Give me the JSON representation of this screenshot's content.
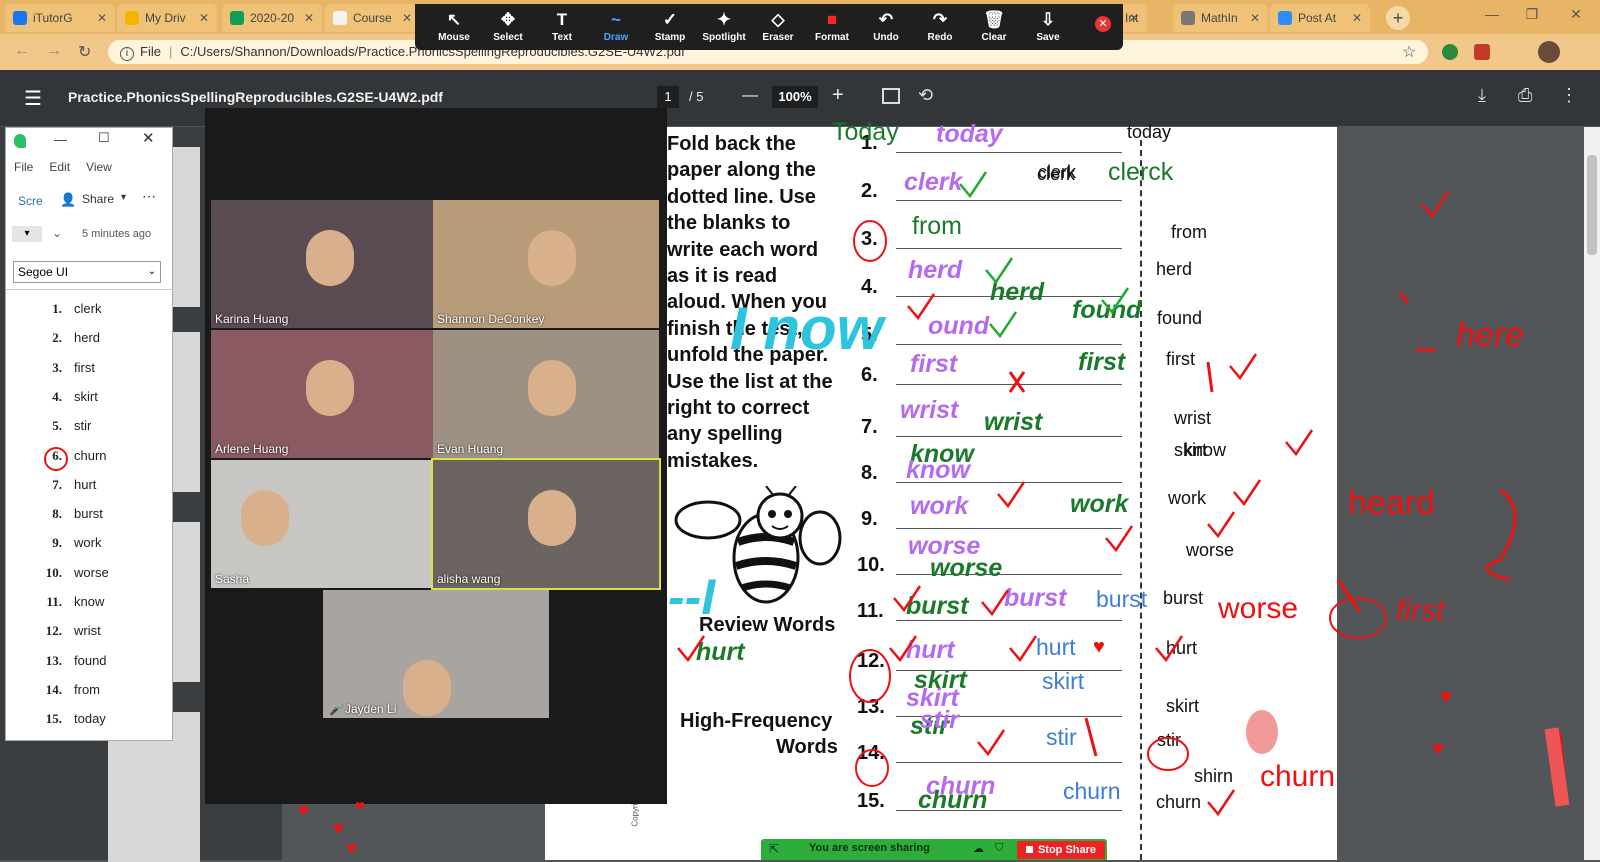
{
  "browser": {
    "tabs": [
      {
        "label": "iTutorG",
        "fav_color": "#1877f2"
      },
      {
        "label": "My Driv",
        "fav_color": "#f4b400"
      },
      {
        "label": "2020-20",
        "fav_color": "#0f9d58"
      },
      {
        "label": "Course",
        "fav_color": "#f3f3f3"
      },
      {
        "label": "Int",
        "fav_color": "#ffffff"
      },
      {
        "label": "MathIn",
        "fav_color": "#777777"
      },
      {
        "label": "Post At",
        "fav_color": "#2d8cff"
      }
    ],
    "new_tab": "+",
    "address_label": "File",
    "url": "C:/Users/Shannon/Downloads/Practice.PhonicsSpellingReproducibles.G2SE-U4W2.pdf"
  },
  "zoom_toolbar": {
    "tools": [
      {
        "label": "Mouse",
        "icon": "↖"
      },
      {
        "label": "Select",
        "icon": "✥"
      },
      {
        "label": "Text",
        "icon": "T"
      },
      {
        "label": "Draw",
        "icon": "~"
      },
      {
        "label": "Stamp",
        "icon": "✓"
      },
      {
        "label": "Spotlight",
        "icon": "✦"
      },
      {
        "label": "Eraser",
        "icon": "◇"
      },
      {
        "label": "Format",
        "icon": "■"
      },
      {
        "label": "Undo",
        "icon": "↶"
      },
      {
        "label": "Redo",
        "icon": "↷"
      },
      {
        "label": "Clear",
        "icon": "🗑"
      },
      {
        "label": "Save",
        "icon": "⇩"
      }
    ]
  },
  "pdf": {
    "title": "Practice.PhonicsSpellingReproducibles.G2SE-U4W2.pdf",
    "page_current": "1",
    "page_total": "/  5",
    "zoom": "100%",
    "zoom_out": "—",
    "zoom_in": "+"
  },
  "evernote": {
    "menu": [
      "File",
      "Edit",
      "View"
    ],
    "scre": "Scre",
    "share": "Share",
    "timestamp": "5 minutes ago",
    "font": "Segoe UI",
    "list": [
      {
        "n": "1.",
        "w": "clerk"
      },
      {
        "n": "2.",
        "w": "herd"
      },
      {
        "n": "3.",
        "w": "first"
      },
      {
        "n": "4.",
        "w": "skirt"
      },
      {
        "n": "5.",
        "w": "stir"
      },
      {
        "n": "6.",
        "w": "churn"
      },
      {
        "n": "7.",
        "w": "hurt"
      },
      {
        "n": "8.",
        "w": "burst"
      },
      {
        "n": "9.",
        "w": "work"
      },
      {
        "n": "10.",
        "w": "worse"
      },
      {
        "n": "11.",
        "w": "know"
      },
      {
        "n": "12.",
        "w": "wrist"
      },
      {
        "n": "13.",
        "w": "found"
      },
      {
        "n": "14.",
        "w": "from"
      },
      {
        "n": "15.",
        "w": "today"
      }
    ]
  },
  "participants": [
    {
      "name": "Karina Huang",
      "bg": "#5a4a52"
    },
    {
      "name": "Shannon DeConkey",
      "bg": "#b89c7a"
    },
    {
      "name": "Arlene Huang",
      "bg": "#8a5a62"
    },
    {
      "name": "Evan Huang",
      "bg": "#9e9184"
    },
    {
      "name": "Sasha",
      "bg": "#c8c6c2"
    },
    {
      "name": "alisha wang",
      "bg": "#6b6460"
    },
    {
      "name": "Jayden Li",
      "bg": "#a8a4a0"
    }
  ],
  "worksheet": {
    "instructions": [
      "Fold back the",
      "paper along the",
      "dotted line. Use",
      "the blanks to",
      "write each word",
      "as it is read",
      "aloud. When you",
      "finish the test,",
      "unfold the paper.",
      "Use the list at the",
      "right to correct",
      "any spelling",
      "mistakes."
    ],
    "numbers": [
      "1.",
      "2.",
      "3.",
      "4.",
      "5.",
      "6.",
      "7.",
      "8.",
      "9.",
      "10.",
      "11.",
      "12.",
      "13.",
      "14.",
      "15."
    ],
    "review_words": "Review Words",
    "hf_words_1": "High-Frequency",
    "hf_words_2": "Words",
    "copyright": "Copyright",
    "answer_list": [
      "today",
      "clerk",
      "from",
      "herd",
      "found",
      "first",
      "wrist",
      "skirt",
      "know",
      "work",
      "worse",
      "burst",
      "hurt",
      "skirt",
      "stir",
      "shirn",
      "churn"
    ],
    "annotations": {
      "today_green": "Today",
      "today_purple": "today",
      "clerk_purple": "clerk",
      "clerk_typed": "clerk",
      "clerk_green": "clerck",
      "from_green": "from",
      "herd_purple": "herd",
      "herd_green": "herd",
      "found_purple": "ound",
      "found_green": "found",
      "first_purple": "first",
      "first_green": "first",
      "wrist_purple": "wrist",
      "wrist_green": "wrist",
      "know_green": "know",
      "know_purple": "know",
      "work_purple": "work",
      "work_green": "work",
      "worse_purple": "worse",
      "worse_green": "worse",
      "burst_green": "burst",
      "burst_purple": "burst",
      "burst_blue": "burst",
      "hurt_green": "hurt",
      "hurt_purple": "hurt",
      "hurt_blue": "hurt",
      "skirt_green": "skirt",
      "skirt_purple": "skirt",
      "skirt_blue": "skirt",
      "stir_green": "stir",
      "stir_purple": "stir",
      "stir_blue": "stir",
      "churn_purple": "churn",
      "churn_green": "churn",
      "churn_blue": "churn",
      "i_now": "I now",
      "i_big": "--I",
      "here": "here",
      "heard": "heard",
      "worse_red": "worse",
      "first_red": "first",
      "churn_red": "churn",
      "skirt_know": "know",
      "shirn": "shirn"
    }
  },
  "share_bar": {
    "label": "You are screen sharing",
    "stop": "Stop Share"
  }
}
